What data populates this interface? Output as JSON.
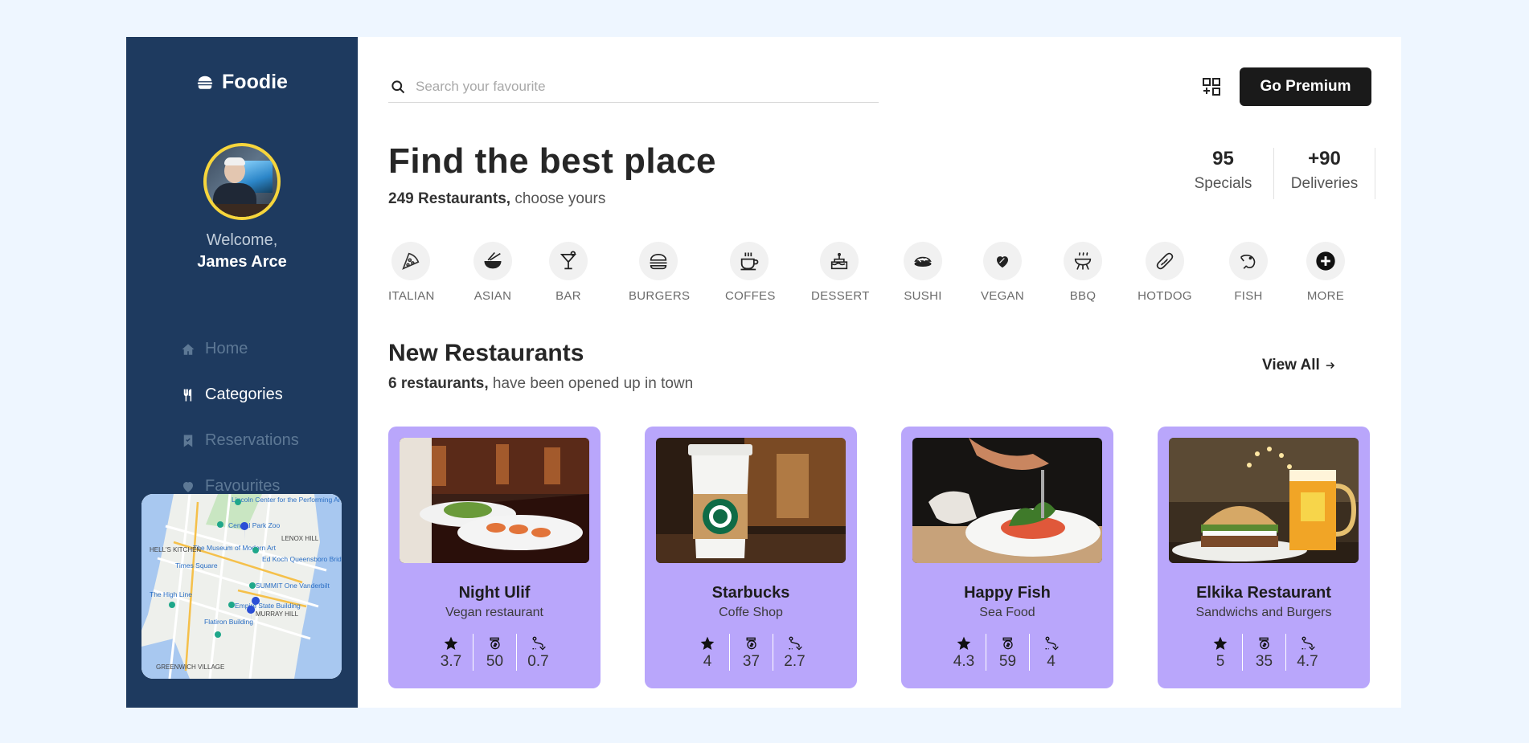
{
  "sidebar": {
    "brand": "Foodie",
    "welcome": "Welcome,",
    "user_name": "James Arce",
    "nav": [
      {
        "label": "Home",
        "icon": "home-icon",
        "active": false
      },
      {
        "label": "Categories",
        "icon": "utensils-icon",
        "active": true
      },
      {
        "label": "Reservations",
        "icon": "bookmark-icon",
        "active": false
      },
      {
        "label": "Favourites",
        "icon": "heart-icon",
        "active": false
      }
    ],
    "map_labels": [
      "Lincoln Center for the Performing Arts",
      "Central Park Zoo",
      "LENOX HILL",
      "HELL'S KITCHEN",
      "The Museum of Modern Art",
      "Times Square",
      "Ed Koch Queensboro Bridge",
      "SUMMIT One Vanderbilt",
      "The High Line",
      "Empire State Building",
      "MURRAY HILL",
      "Flatiron Building",
      "GREENWICH VILLAGE"
    ]
  },
  "header": {
    "search_placeholder": "Search your favourite",
    "premium_label": "Go Premium"
  },
  "hero": {
    "title": "Find the best place",
    "count_bold": "249 Restaurants,",
    "count_rest": " choose yours",
    "stats": [
      {
        "value": "95",
        "label": "Specials"
      },
      {
        "value": "+90",
        "label": "Deliveries"
      }
    ]
  },
  "categories": [
    {
      "label": "ITALIAN",
      "icon": "pizza-icon"
    },
    {
      "label": "ASIAN",
      "icon": "noodle-bowl-icon"
    },
    {
      "label": "BAR",
      "icon": "cocktail-icon"
    },
    {
      "label": "BURGERS",
      "icon": "burger-icon"
    },
    {
      "label": "COFFES",
      "icon": "coffee-cup-icon"
    },
    {
      "label": "DESSERT",
      "icon": "cake-icon"
    },
    {
      "label": "SUSHI",
      "icon": "sushi-icon"
    },
    {
      "label": "VEGAN",
      "icon": "leaf-heart-icon"
    },
    {
      "label": "BBQ",
      "icon": "grill-icon"
    },
    {
      "label": "HOTDOG",
      "icon": "hotdog-icon"
    },
    {
      "label": "FISH",
      "icon": "shrimp-icon"
    },
    {
      "label": "MORE",
      "icon": "plus-circle-icon"
    }
  ],
  "new_restaurants": {
    "title": "New Restaurants",
    "count_bold": "6 restaurants,",
    "count_rest": " have been opened up in town",
    "view_all": "View All",
    "cards": [
      {
        "name": "Night Ulif",
        "type": "Vegan restaurant",
        "rating": "3.7",
        "price": "50",
        "distance": "0.7"
      },
      {
        "name": "Starbucks",
        "type": "Coffe Shop",
        "rating": "4",
        "price": "37",
        "distance": "2.7"
      },
      {
        "name": "Happy Fish",
        "type": "Sea Food",
        "rating": "4.3",
        "price": "59",
        "distance": "4"
      },
      {
        "name": "Elkika Restaurant",
        "type": "Sandwichs and Burgers",
        "rating": "5",
        "price": "35",
        "distance": "4.7"
      }
    ]
  },
  "colors": {
    "sidebar_bg": "#1e3a5f",
    "card_bg": "#b9a6fb",
    "accent_ring": "#f6d53c",
    "premium_bg": "#1a1a1a"
  }
}
